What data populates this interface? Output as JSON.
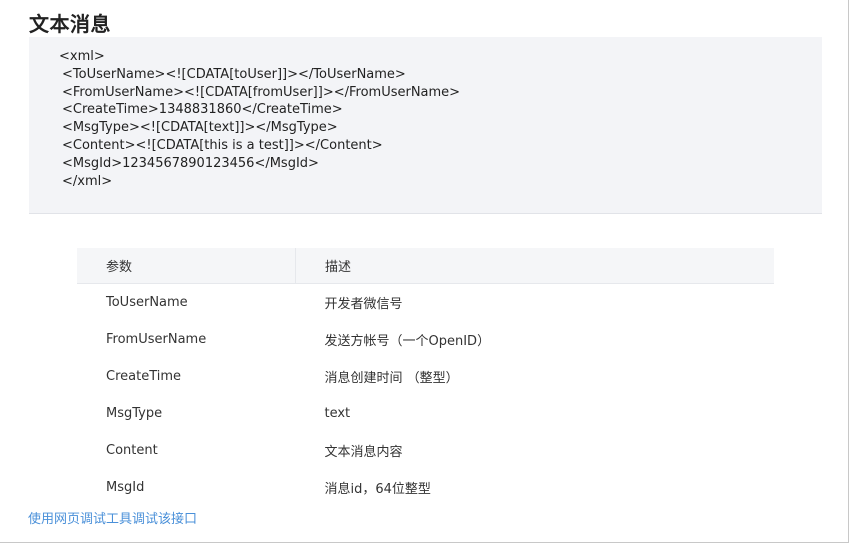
{
  "title": "文本消息",
  "code": {
    "lines": [
      "<xml>",
      "<ToUserName><![CDATA[toUser]]></ToUserName>",
      "<FromUserName><![CDATA[fromUser]]></FromUserName>",
      "<CreateTime>1348831860</CreateTime>",
      "<MsgType><![CDATA[text]]></MsgType>",
      "<Content><![CDATA[this is a test]]></Content>",
      "<MsgId>1234567890123456</MsgId>",
      "</xml>"
    ]
  },
  "table": {
    "headers": [
      "参数",
      "描述"
    ],
    "rows": [
      {
        "param": "ToUserName",
        "desc": "开发者微信号"
      },
      {
        "param": "FromUserName",
        "desc": "发送方帐号（一个OpenID）"
      },
      {
        "param": "CreateTime",
        "desc": "消息创建时间 （整型）"
      },
      {
        "param": "MsgType",
        "desc": "text"
      },
      {
        "param": "Content",
        "desc": "文本消息内容"
      },
      {
        "param": "MsgId",
        "desc": "消息id，64位整型"
      }
    ]
  },
  "link": {
    "label": "使用网页调试工具调试该接口"
  },
  "colors": {
    "link": "#4a90d9",
    "code_bg": "#f3f4f7",
    "table_header_bg": "#f5f6f8"
  }
}
